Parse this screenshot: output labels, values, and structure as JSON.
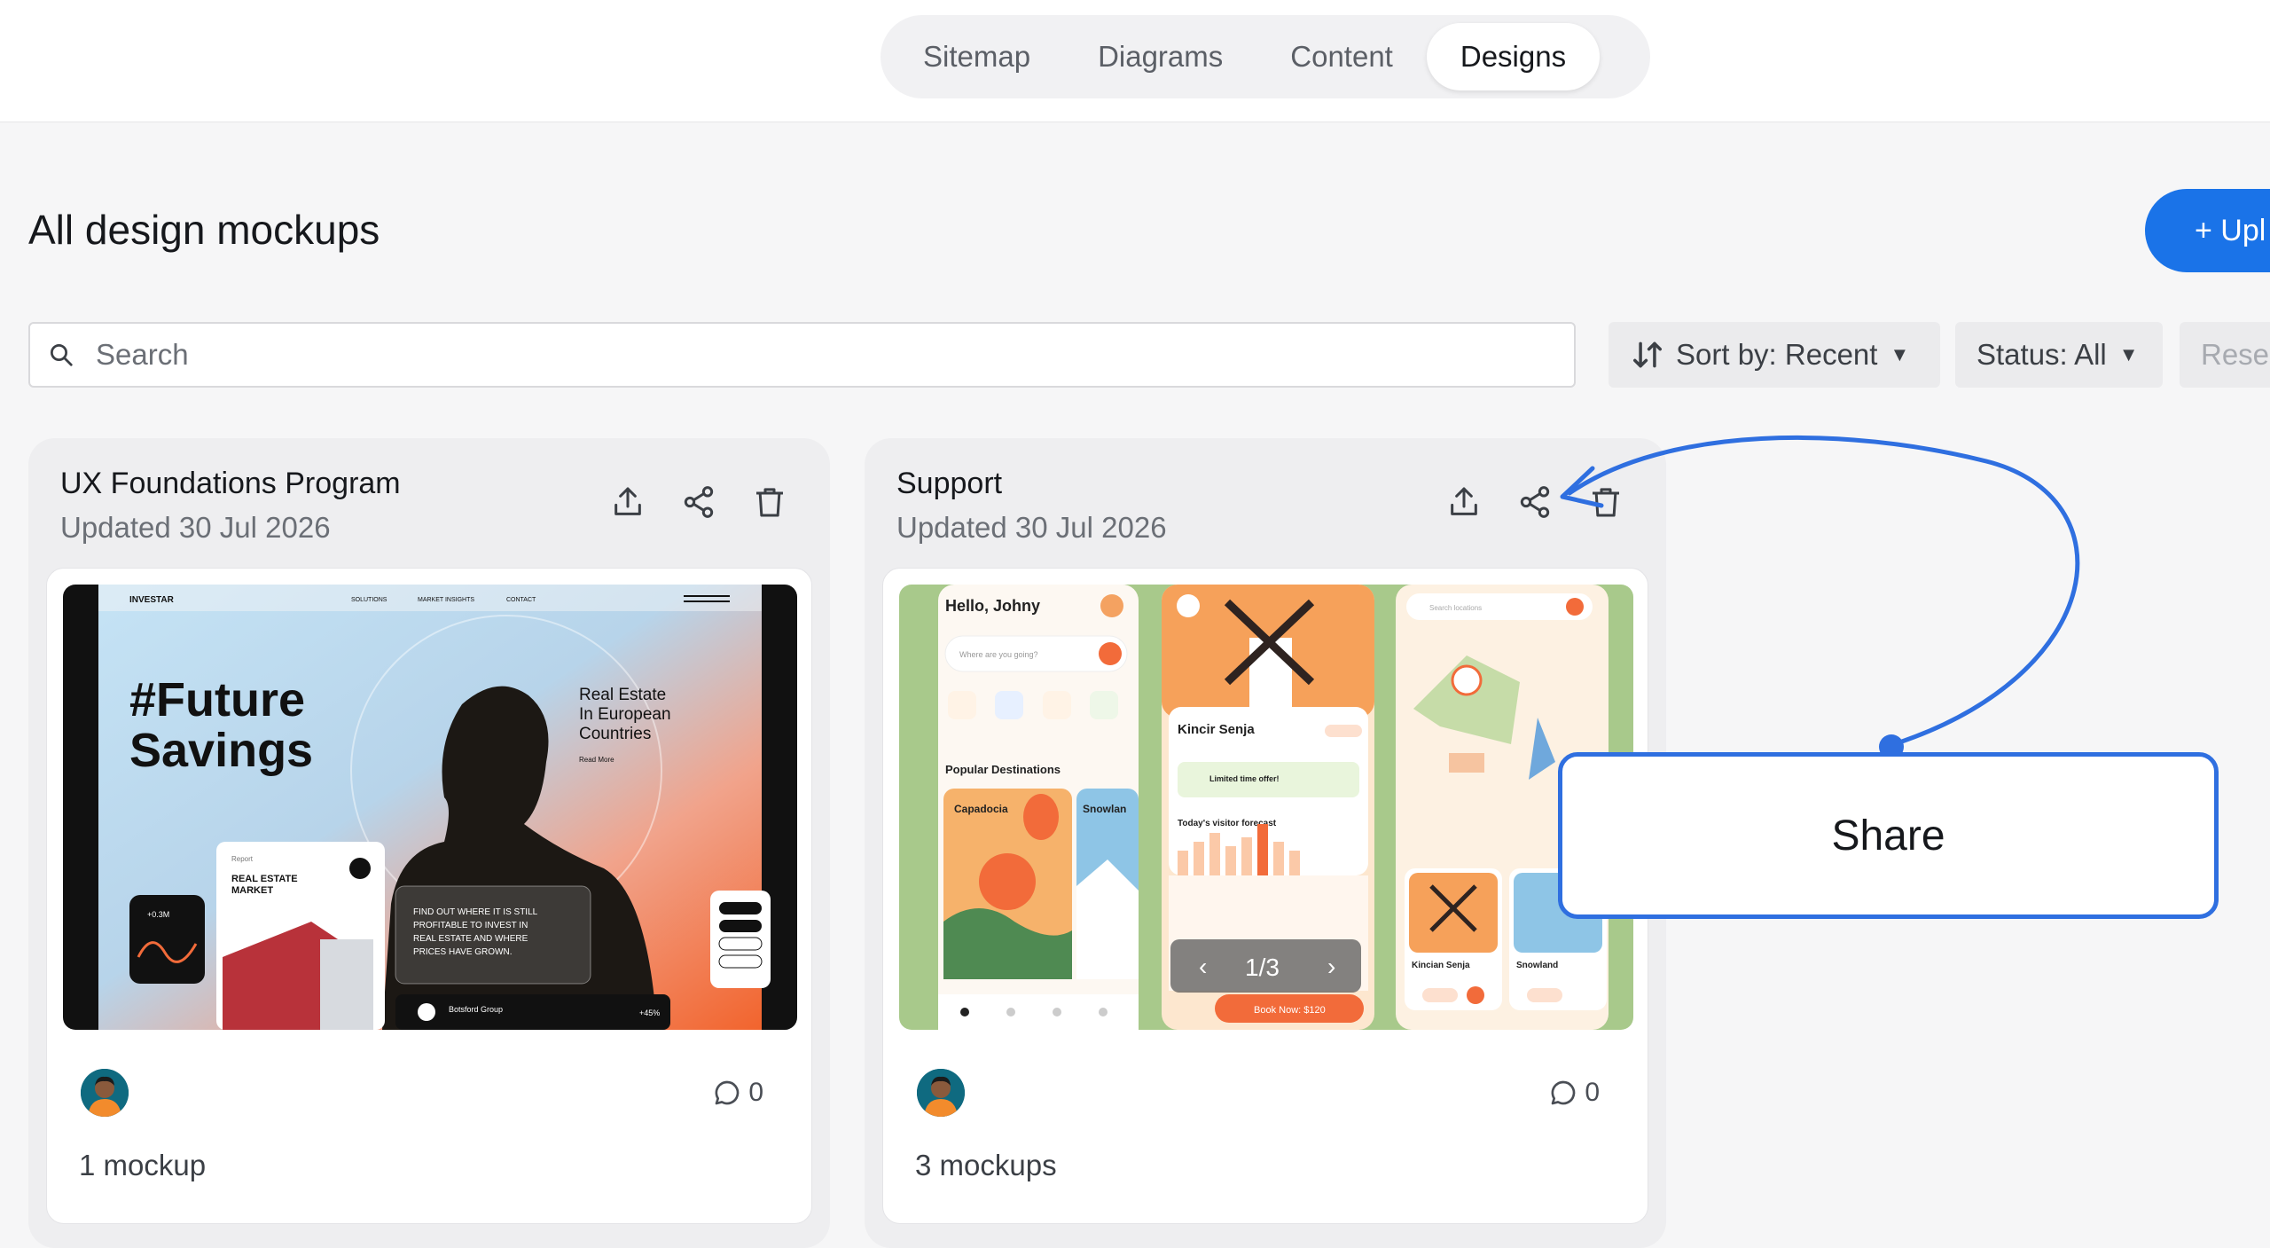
{
  "tabs": [
    {
      "label": "Sitemap",
      "active": false
    },
    {
      "label": "Diagrams",
      "active": false
    },
    {
      "label": "Content",
      "active": false
    },
    {
      "label": "Designs",
      "active": true
    }
  ],
  "page": {
    "title": "All design mockups",
    "upload_label": "+ Upl"
  },
  "search": {
    "placeholder": "Search",
    "value": ""
  },
  "filters": {
    "sort_label": "Sort by: Recent",
    "status_label": "Status: All",
    "reset_label": "Rese"
  },
  "cards": [
    {
      "title": "UX Foundations Program",
      "updated": "Updated 30 Jul 2026",
      "comment_count": "0",
      "mockup_count": "1 mockup",
      "thumb": {
        "brand": "INVESTAR",
        "nav": [
          "SOLUTIONS",
          "MARKET INSIGHTS",
          "CONTACT"
        ],
        "headline_1": "#Future",
        "headline_2": "Savings",
        "side_1": "Real Estate",
        "side_2": "In European",
        "side_3": "Countries",
        "read_more": "Read More",
        "card_label": "Report",
        "card_title_1": "REAL ESTATE",
        "card_title_2": "MARKET",
        "stat": "+0.3M",
        "blurb_1": "FIND OUT WHERE IT IS STILL",
        "blurb_2": "PROFITABLE TO INVEST IN",
        "blurb_3": "REAL ESTATE AND WHERE",
        "blurb_4": "PRICES HAVE GROWN.",
        "footer_name": "Botsford Group",
        "footer_pct": "+45%"
      }
    },
    {
      "title": "Support",
      "updated": "Updated 30 Jul 2026",
      "comment_count": "0",
      "mockup_count": "3 mockups",
      "thumb": {
        "greeting": "Hello, Johny",
        "search_hint": "Where are you going?",
        "section": "Popular Destinations",
        "dest_1": "Capadocia",
        "dest_2": "Snowlan",
        "place": "Kincir Senja",
        "offer": "Limited time offer!",
        "forecast": "Today's visitor forecast",
        "pager": "1/3",
        "book": "Book Now: $120",
        "map_search": "Search locations",
        "map_1": "Kincian Senja",
        "map_2": "Snowland"
      }
    }
  ],
  "tooltip": {
    "label": "Share"
  },
  "colors": {
    "accent": "#1a73e8",
    "annotation": "#2f6fe0",
    "orange": "#f26b3a"
  }
}
